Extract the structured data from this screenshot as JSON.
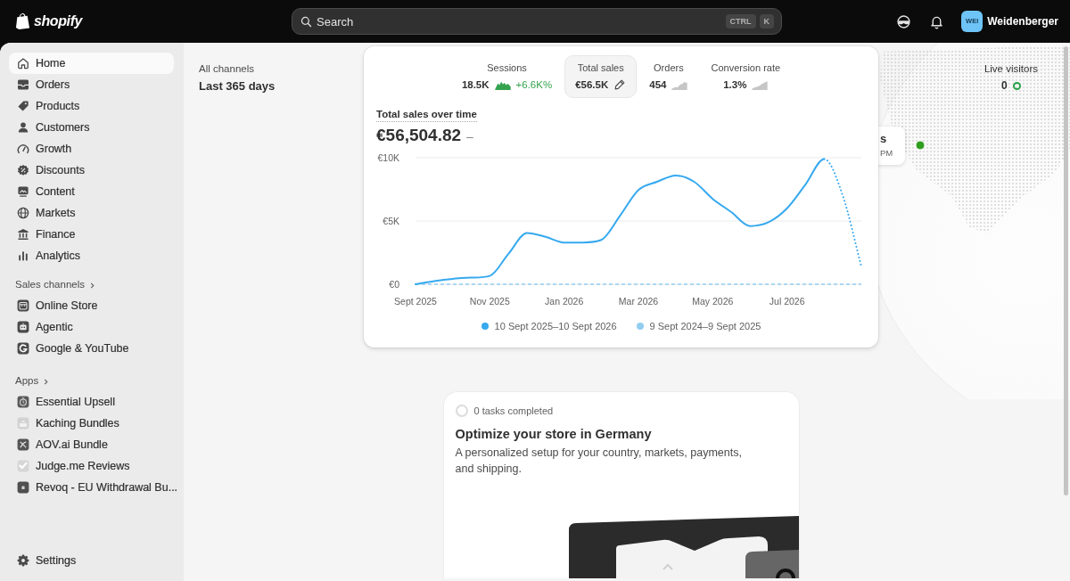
{
  "top_bar": {
    "logo": "shopify",
    "search": {
      "placeholder": "Search",
      "shortcut": [
        "CTRL",
        "K"
      ]
    },
    "user": {
      "initials": "WEI",
      "name": "Weidenberger"
    }
  },
  "sidebar": {
    "items": [
      {
        "label": "Home",
        "selected": true
      },
      {
        "label": "Orders",
        "selected": false
      },
      {
        "label": "Products",
        "selected": false
      },
      {
        "label": "Customers",
        "selected": false
      },
      {
        "label": "Growth",
        "selected": false
      },
      {
        "label": "Discounts",
        "selected": false
      },
      {
        "label": "Content",
        "selected": false
      },
      {
        "label": "Markets",
        "selected": false
      },
      {
        "label": "Finance",
        "selected": false
      },
      {
        "label": "Analytics",
        "selected": false
      }
    ],
    "sections": [
      {
        "title": "Sales channels",
        "items": [
          {
            "label": "Online Store",
            "selected": false
          },
          {
            "label": "Agentic",
            "selected": false
          },
          {
            "label": "Google & YouTube",
            "selected": false
          }
        ]
      },
      {
        "title": "Apps",
        "items": [
          {
            "label": "Essential Upsell",
            "selected": false
          },
          {
            "label": "Kaching Bundles",
            "selected": false
          },
          {
            "label": "AOV.ai Bundle",
            "selected": false
          },
          {
            "label": "Judge.me Reviews",
            "selected": false
          },
          {
            "label": "Revoq - EU Withdrawal Bu...",
            "selected": false
          }
        ]
      }
    ],
    "footer": [
      {
        "label": "Settings",
        "selected": false
      }
    ]
  },
  "filters": {
    "channel": "All channels",
    "period": "Last 365 days"
  },
  "sales_card": {
    "metrics": [
      {
        "label": "Sessions",
        "value": "18.5K",
        "change": "+6.6K%",
        "color": "#34a34f",
        "selected": false
      },
      {
        "label": "Total sales",
        "value": "€56.5K",
        "selected": true
      },
      {
        "label": "Orders",
        "value": "454",
        "color": "#c6c6c6",
        "selected": false
      },
      {
        "label": "Conversion rate",
        "value": "1.3%",
        "color": "#c6c6c6",
        "selected": false
      }
    ],
    "title": "Total sales over time",
    "total": "€56,504.82",
    "total_change": "–",
    "chart_data": {
      "type": "line",
      "categories": [
        "Sept 2025",
        null,
        null,
        null,
        "Nov 2025",
        null,
        null,
        null,
        "Jan 2026",
        null,
        null,
        null,
        "Mar 2026",
        null,
        null,
        null,
        "May 2026",
        null,
        null,
        null,
        "Jul 2026",
        null,
        null,
        null,
        null
      ],
      "series": [
        {
          "name": "10 Sept 2025–10 Sept 2026",
          "color": "#36a9ef",
          "line_style": "solid",
          "values": [
            0,
            250,
            430,
            520,
            660,
            2400,
            4050,
            3750,
            3300,
            3300,
            3500,
            5400,
            7450,
            8100,
            8600,
            8100,
            6750,
            5700,
            4600,
            4900,
            6000,
            7900,
            9900,
            null,
            null
          ]
        },
        {
          "color": "#36a9ef",
          "line_style": "dotted",
          "values": [
            null,
            null,
            null,
            null,
            null,
            null,
            null,
            null,
            null,
            null,
            null,
            null,
            null,
            null,
            null,
            null,
            null,
            null,
            null,
            null,
            null,
            null,
            9900,
            7000,
            1400
          ]
        },
        {
          "name": "9 Sept 2024–9 Sept 2025",
          "color": "#92cdf0",
          "line_style": "dashed",
          "values": [
            0,
            0,
            0,
            0,
            0,
            0,
            0,
            0,
            0,
            0,
            0,
            0,
            0,
            0,
            0,
            0,
            0,
            0,
            0,
            0,
            0,
            0,
            0,
            0,
            0
          ]
        }
      ],
      "ylim": [
        0,
        10000
      ],
      "yticks": [
        {
          "value": 0,
          "label": "€0"
        },
        {
          "value": 5000,
          "label": "€5K"
        },
        {
          "value": 10000,
          "label": "€10K"
        }
      ],
      "legend": "bottom"
    }
  },
  "map_popup": {
    "title": "s",
    "time": "PM"
  },
  "live_visitors": {
    "label": "Live visitors",
    "count": "0"
  },
  "setup_card": {
    "progress": "0 tasks completed",
    "title": "Optimize your store in Germany",
    "description": "A personalized setup for your country, markets, payments, and shipping."
  }
}
